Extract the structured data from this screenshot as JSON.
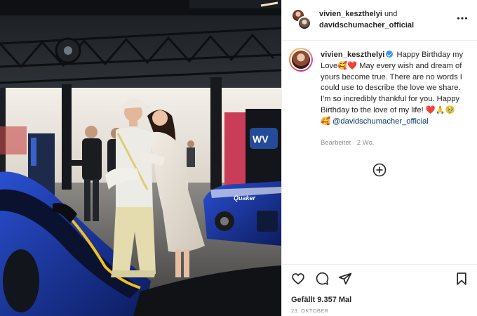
{
  "post": {
    "photo": {
      "description_icon": "photo-image",
      "sponsor_text": "WV",
      "car_text": "Quaker"
    },
    "header": {
      "user1": "vivien_keszthelyi",
      "conjunction": "und",
      "user2": "davidschumacher_official",
      "more_icon": "more-horizontal-icon"
    },
    "caption": {
      "username": "vivien_keszthelyi",
      "verified_icon": "verified-badge-icon",
      "text": "Happy Birthday my Love🥰❤️ May every wish and dream of yours become true. There are no words I could use to describe the love we share. I'm so incredibly thankful for you. Happy Birthday to the love of my life! ❤️🙏🥹🥰",
      "mention": "@davidschumacher_official",
      "edited": "Bearbeitet",
      "separator": "·",
      "age": "2 Wo.",
      "add_icon": "plus-circle-icon"
    },
    "actions": {
      "like_icon": "heart-icon",
      "comment_icon": "comment-icon",
      "share_icon": "send-icon",
      "save_icon": "bookmark-icon",
      "likes": "Gefällt 9.357 Mal",
      "date": "23. OKTOBER"
    },
    "colors": {
      "text": "#262626",
      "secondary": "#8e8e8e",
      "mention": "#00376b",
      "verified": "#3897f0",
      "car_blue": "#1f3fa8"
    }
  }
}
